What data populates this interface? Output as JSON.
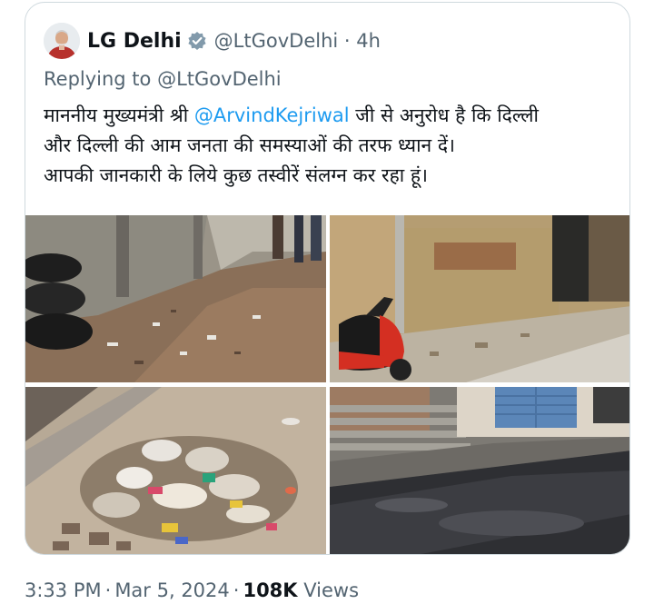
{
  "quoted_tweet": {
    "author_name": "LG Delhi",
    "verified": true,
    "handle": "@LtGovDelhi",
    "separator": "·",
    "relative_time": "4h",
    "replying_prefix": "Replying to",
    "replying_to": "@LtGovDelhi",
    "text": {
      "line1_before": "माननीय मुख्यमंत्री श्री ",
      "line1_mention": "@ArvindKejriwal",
      "line1_after": " जी से अनुरोध है कि दिल्ली",
      "line2": "और दिल्ली की आम जनता की समस्याओं की तरफ ध्यान दें।",
      "line3": "आपकी जानकारी के लिये कुछ तस्वीरें संलग्न कर रहा हूं।"
    },
    "media": [
      {
        "icon": "photo-icon",
        "subject": "garbage-in-lane"
      },
      {
        "icon": "photo-icon",
        "subject": "scooter-garbage-wall"
      },
      {
        "icon": "photo-icon",
        "subject": "garbage-heap"
      },
      {
        "icon": "photo-icon",
        "subject": "dirty-water-shops"
      }
    ]
  },
  "footer": {
    "time": "3:33 PM",
    "dot": "·",
    "date": "Mar 5, 2024",
    "views_count": "108K",
    "views_label": "Views"
  },
  "colors": {
    "text_primary": "#0f1419",
    "text_secondary": "#536471",
    "link": "#1d9bf0",
    "border": "#cfd9de",
    "verified_badge": "#829aab"
  }
}
